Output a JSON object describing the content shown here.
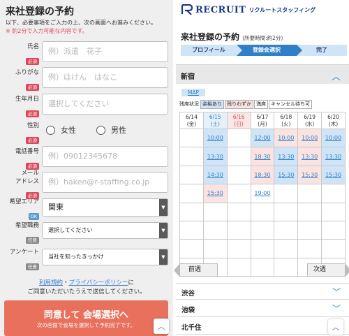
{
  "left": {
    "title": "来社登録の予約",
    "intro": "以下、必要事項をご入力の上、次の画面へお進みください。",
    "note": "※ 約2分で入力可能な内容です。",
    "fields": {
      "name": {
        "label": "氏名",
        "badge": "必須",
        "placeholder": "例）派遣　花子"
      },
      "furigana": {
        "label": "ふりがな",
        "badge": "必須",
        "placeholder": "例）はけん　はなこ"
      },
      "birthday": {
        "label": "生年月日",
        "badge": "必須",
        "placeholder": "選択してください"
      },
      "gender": {
        "label": "性別",
        "badge": "必須",
        "opt_female": "女性",
        "opt_male": "男性"
      },
      "phone": {
        "label": "電話番号",
        "badge": "必須",
        "placeholder": "例）09012345678"
      },
      "email": {
        "label1": "メール",
        "label2": "アドレス",
        "badge": "必須",
        "placeholder": "例）haken@r-staffing.co.jp"
      },
      "area": {
        "label": "希望エリア",
        "badge": "OK",
        "value": "関東"
      },
      "job": {
        "label": "希望職務",
        "badge": "任意",
        "value": "選択してください"
      },
      "survey": {
        "label": "アンケート",
        "badge": "任意",
        "value": "当社を知ったきっかけ"
      }
    },
    "terms": {
      "link1": "利用規約",
      "sep": "・",
      "link2": "プライバシーポリシー",
      "tail1": "に",
      "line2": "ご同意いただいたうえで送信してください。"
    },
    "cta": {
      "main": "同意して 会場選択へ",
      "sub": "次の画面で会場を選択して予約完了です。"
    },
    "scroll_top": "︿"
  },
  "right": {
    "logo": {
      "name": "RECRUIT",
      "sub": "リクルートスタッフィング"
    },
    "title": "来社登録の予約",
    "title_note": "(所要時間:約2分)",
    "steps": [
      "プロフィール",
      "登録会選択",
      "完了"
    ],
    "area_open": "新宿",
    "map": "MAP",
    "legend": {
      "title": "残席状況",
      "items": [
        "余裕あり",
        "残りわずか",
        "満席",
        "キャンセル待ち可"
      ]
    },
    "days": [
      {
        "date": "6/14",
        "dow": "(金)",
        "type": "weekday"
      },
      {
        "date": "6/15",
        "dow": "(土)",
        "type": "sat"
      },
      {
        "date": "6/16",
        "dow": "(日)",
        "type": "sun"
      },
      {
        "date": "6/17",
        "dow": "(月)",
        "type": "weekday"
      },
      {
        "date": "6/18",
        "dow": "(火)",
        "type": "weekday"
      },
      {
        "date": "6/19",
        "dow": "(水)",
        "type": "weekday"
      },
      {
        "date": "6/20",
        "dow": "(木)",
        "type": "weekday"
      }
    ],
    "slots": [
      [
        {
          "t": "",
          "c": ""
        },
        {
          "t": "10:00",
          "c": "blue"
        },
        {
          "t": "",
          "c": ""
        },
        {
          "t": "12:00",
          "c": "blue"
        },
        {
          "t": "10:00",
          "c": "pink"
        },
        {
          "t": "10:00",
          "c": "pink"
        },
        {
          "t": "10:00",
          "c": "blue"
        }
      ],
      [
        {
          "t": "",
          "c": ""
        },
        {
          "t": "13:30",
          "c": "blue"
        },
        {
          "t": "",
          "c": ""
        },
        {
          "t": "18:30",
          "c": "pink"
        },
        {
          "t": "13:30",
          "c": "blue"
        },
        {
          "t": "13:30",
          "c": "pink"
        },
        {
          "t": "13:30",
          "c": "blue"
        }
      ],
      [
        {
          "t": "",
          "c": ""
        },
        {
          "t": "14:30",
          "c": "blue"
        },
        {
          "t": "",
          "c": ""
        },
        {
          "t": "18:30",
          "c": "pink"
        },
        {
          "t": "15:30",
          "c": "blue"
        },
        {
          "t": "15:30",
          "c": "pink"
        },
        {
          "t": "15:30",
          "c": "blue"
        }
      ],
      [
        {
          "t": "",
          "c": ""
        },
        {
          "t": "15:30",
          "c": "pink"
        },
        {
          "t": "",
          "c": ""
        },
        {
          "t": "19:00",
          "c": ""
        },
        {
          "t": "",
          "c": ""
        },
        {
          "t": "",
          "c": ""
        },
        {
          "t": "",
          "c": ""
        }
      ],
      [
        {
          "t": "",
          "c": ""
        },
        {
          "t": "",
          "c": ""
        },
        {
          "t": "",
          "c": ""
        },
        {
          "t": "",
          "c": ""
        },
        {
          "t": "",
          "c": ""
        },
        {
          "t": "",
          "c": ""
        },
        {
          "t": "",
          "c": ""
        }
      ],
      [
        {
          "t": "",
          "c": ""
        },
        {
          "t": "",
          "c": ""
        },
        {
          "t": "",
          "c": ""
        },
        {
          "t": "",
          "c": ""
        },
        {
          "t": "",
          "c": ""
        },
        {
          "t": "",
          "c": ""
        },
        {
          "t": "",
          "c": ""
        }
      ],
      [
        {
          "t": "",
          "c": ""
        },
        {
          "t": "",
          "c": ""
        },
        {
          "t": "",
          "c": ""
        },
        {
          "t": "",
          "c": ""
        },
        {
          "t": "",
          "c": ""
        },
        {
          "t": "",
          "c": ""
        },
        {
          "t": "",
          "c": ""
        }
      ],
      [
        {
          "t": "",
          "c": ""
        },
        {
          "t": "",
          "c": ""
        },
        {
          "t": "",
          "c": ""
        },
        {
          "t": "",
          "c": ""
        },
        {
          "t": "",
          "c": ""
        },
        {
          "t": "",
          "c": ""
        },
        {
          "t": "",
          "c": ""
        }
      ]
    ],
    "prev_week": "前週",
    "next_week": "次週",
    "areas": [
      "渋谷",
      "池袋",
      "北千住"
    ]
  },
  "colors": {
    "accent": "#2f7fc9",
    "cta": "#e8705d",
    "required": "#e0475a",
    "available": "#cfe4f7",
    "few_left": "#fbe3e1"
  }
}
